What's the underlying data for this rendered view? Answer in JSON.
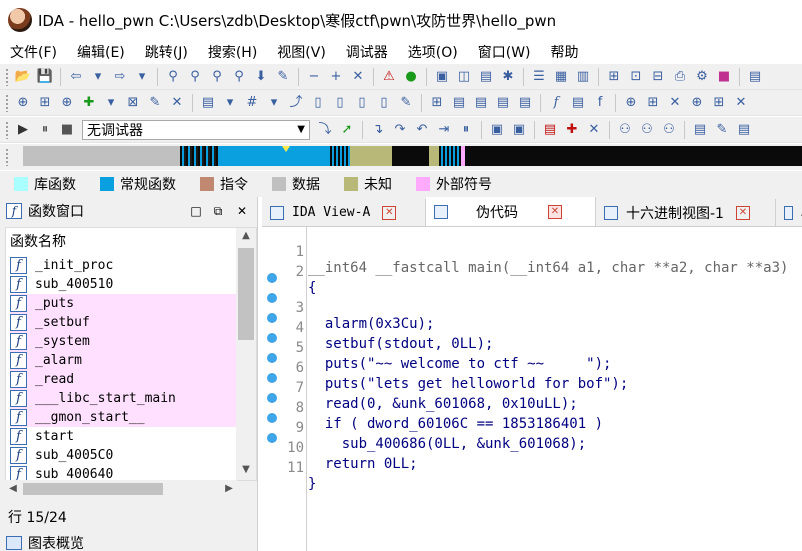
{
  "window": {
    "title": "IDA - hello_pwn C:\\Users\\zdb\\Desktop\\寒假ctf\\pwn\\攻防世界\\hello_pwn"
  },
  "menu": [
    "文件(F)",
    "编辑(E)",
    "跳转(J)",
    "搜索(H)",
    "视图(V)",
    "调试器",
    "选项(O)",
    "窗口(W)",
    "帮助"
  ],
  "debugger": {
    "selected": "无调试器"
  },
  "legend": [
    {
      "label": "库函数",
      "color": "#aaffff"
    },
    {
      "label": "常规函数",
      "color": "#0aa0e0"
    },
    {
      "label": "指令",
      "color": "#c08870"
    },
    {
      "label": "数据",
      "color": "#c0c0c0"
    },
    {
      "label": "未知",
      "color": "#b8b878"
    },
    {
      "label": "外部符号",
      "color": "#ffaaff"
    }
  ],
  "functions_pane": {
    "title": "函数窗口",
    "column_header": "函数名称",
    "items": [
      "_init_proc",
      "sub_400510",
      "_puts",
      "_setbuf",
      "_system",
      "_alarm",
      "_read",
      "___libc_start_main",
      "__gmon_start__",
      "start",
      "sub_4005C0",
      "sub_400640"
    ],
    "status": "行 15/24"
  },
  "overview_pane": {
    "title": "图表概览"
  },
  "tabs": [
    "IDA View-A",
    "伪代码",
    "十六进制视图-1",
    "A"
  ],
  "code": {
    "line_numbers": [
      "1",
      "2",
      "3",
      "4",
      "5",
      "6",
      "7",
      "8",
      "9",
      "10",
      "11"
    ],
    "lines": [
      "__int64 __fastcall main(__int64 a1, char **a2, char **a3)",
      "{",
      "  alarm(0x3Cu);",
      "  setbuf(stdout, 0LL);",
      "  puts(\"~~ welcome to ctf ~~     \");",
      "  puts(\"lets get helloworld for bof\");",
      "  read(0, &unk_601068, 0x10uLL);",
      "  if ( dword_60106C == 1853186401 )",
      "    sub_400686(0LL, &unk_601068);",
      "  return 0LL;",
      "}"
    ]
  }
}
